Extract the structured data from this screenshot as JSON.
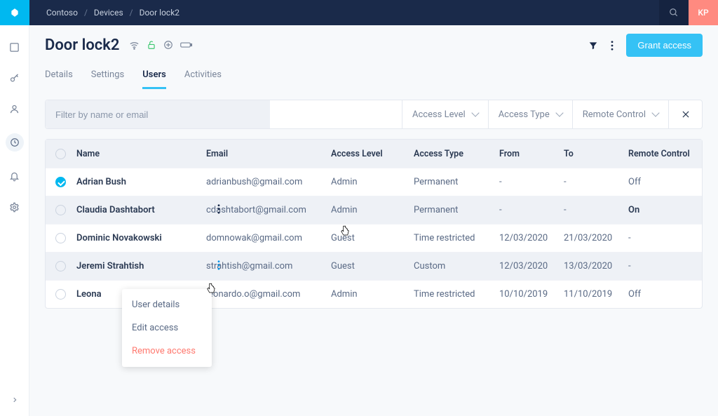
{
  "breadcrumb": [
    "Contoso",
    "Devices",
    "Door lock2"
  ],
  "avatar": "KP",
  "title": "Door lock2",
  "grant_label": "Grant access",
  "tabs": [
    "Details",
    "Settings",
    "Users",
    "Activities"
  ],
  "active_tab": 2,
  "filter": {
    "placeholder": "Filter by name or email",
    "dd_access_level": "Access Level",
    "dd_access_type": "Access Type",
    "dd_remote": "Remote Control"
  },
  "columns": {
    "name": "Name",
    "email": "Email",
    "al": "Access Level",
    "at": "Access Type",
    "from": "From",
    "to": "To",
    "rc": "Remote Control"
  },
  "rows": [
    {
      "checked": true,
      "hover": false,
      "name": "Adrian Bush",
      "email": "adrianbush@gmail.com",
      "al": "Admin",
      "at": "Permanent",
      "from": "-",
      "to": "-",
      "rc": "Off",
      "bold_rc": false
    },
    {
      "checked": false,
      "hover": true,
      "name": "Claudia Dashtabort",
      "email": "cdashtabort@gmail.com",
      "al": "Admin",
      "at": "Permanent",
      "from": "-",
      "to": "-",
      "rc": "On",
      "bold_rc": true
    },
    {
      "checked": false,
      "hover": false,
      "name": "Dominic Novakowski",
      "email": "domnowak@gmail.com",
      "al": "Guest",
      "at": "Time restricted",
      "from": "12/03/2020",
      "to": "21/03/2020",
      "rc": "-",
      "bold_rc": false
    },
    {
      "checked": false,
      "hover": true,
      "name": "Jeremi Strahtish",
      "email": "strahtish@gmail.com",
      "al": "Guest",
      "at": "Custom",
      "from": "12/03/2020",
      "to": "13/03/2020",
      "rc": "-",
      "bold_rc": false
    },
    {
      "checked": false,
      "hover": false,
      "name": "Leona",
      "email": "leonardo.o@gmail.com",
      "al": "Admin",
      "at": "Time restricted",
      "from": "10/10/2019",
      "to": "11/10/2019",
      "rc": "Off",
      "bold_rc": false
    }
  ],
  "ctx": {
    "details": "User details",
    "edit": "Edit access",
    "remove": "Remove access"
  }
}
